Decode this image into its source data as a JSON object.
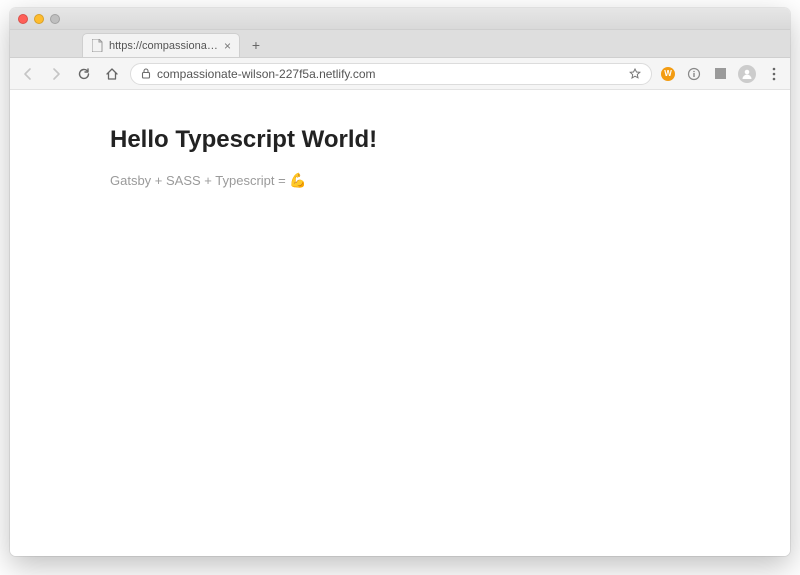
{
  "window": {
    "tab_title": "https://compassionate-wilson",
    "url_display": "compassionate-wilson-227f5a.netlify.com"
  },
  "page": {
    "heading": "Hello Typescript World!",
    "tagline_text": "Gatsby + SASS + Typescript = ",
    "tagline_emoji": "💪"
  },
  "icons": {
    "extension_label": "W"
  }
}
